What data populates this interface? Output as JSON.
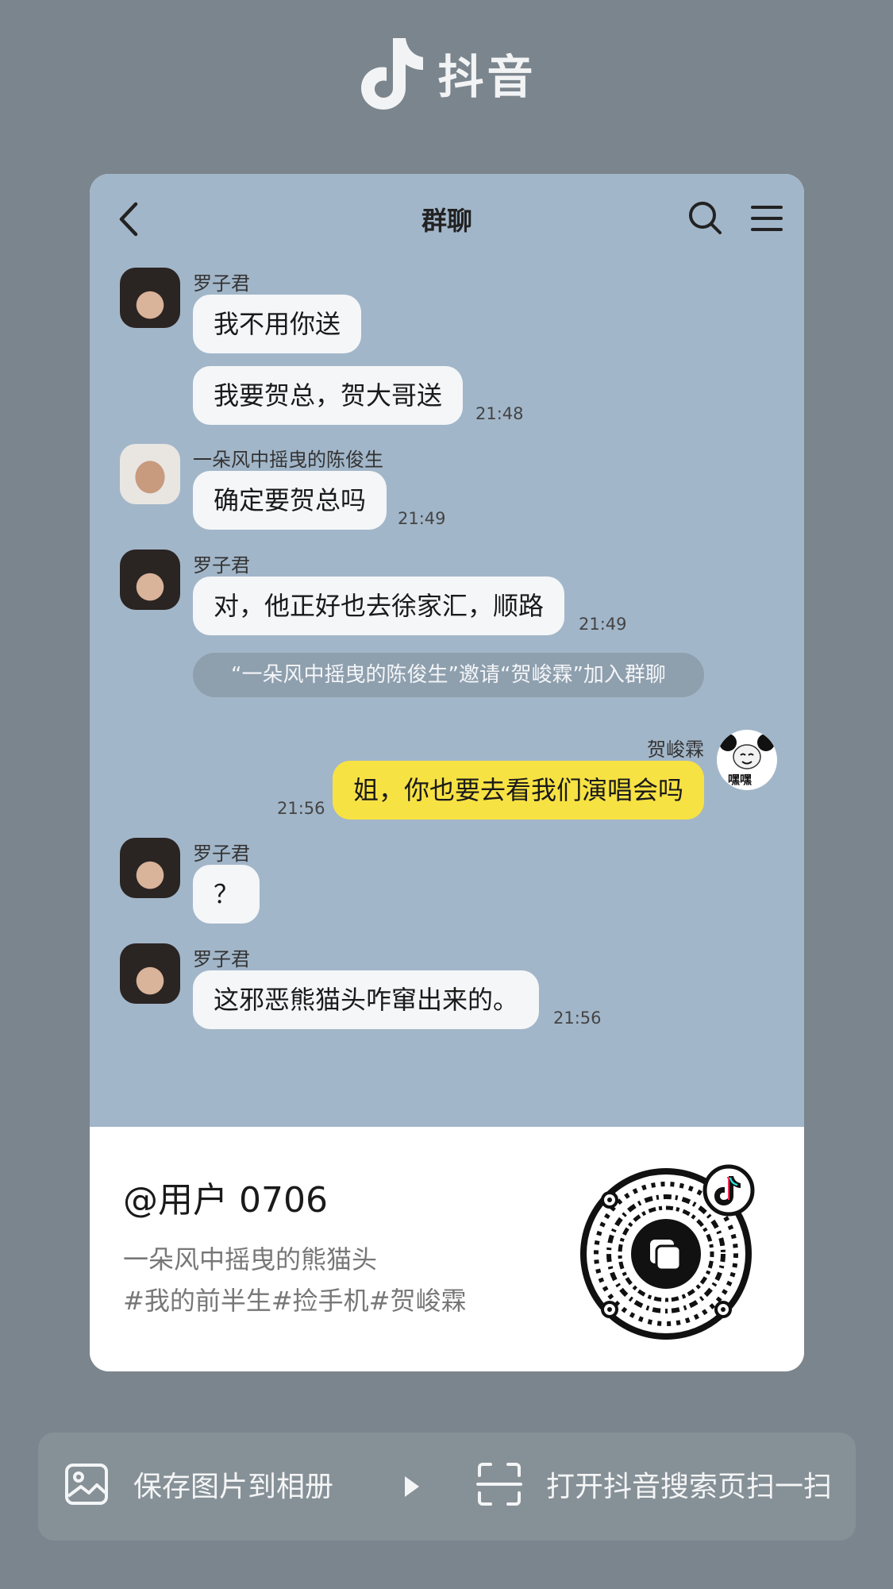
{
  "brand": {
    "name": "抖音"
  },
  "chat": {
    "title": "群聊",
    "messages": [
      {
        "sender": "罗子君",
        "bubbles": [
          "我不用你送",
          "我要贺总，贺大哥送"
        ],
        "time": "21:48"
      },
      {
        "sender": "一朵风中摇曳的陈俊生",
        "bubbles": [
          "确定要贺总吗"
        ],
        "time": "21:49"
      },
      {
        "sender": "罗子君",
        "bubbles": [
          "对，他正好也去徐家汇，顺路"
        ],
        "time": "21:49"
      },
      {
        "system": "“一朵风中摇曳的陈俊生”邀请“贺峻霖”加入群聊"
      },
      {
        "sender": "贺峻霖",
        "bubbles": [
          "姐，你也要去看我们演唱会吗"
        ],
        "time": "21:56",
        "avatar_text": "嘿嘿"
      },
      {
        "sender": "罗子君",
        "bubbles": [
          "？"
        ]
      },
      {
        "sender": "罗子君",
        "bubbles": [
          "这邪恶熊猫头咋窜出来的。"
        ],
        "time": "21:56"
      }
    ]
  },
  "info": {
    "username": "@用户 0706",
    "desc_line1": "一朵风中摇曳的熊猫头",
    "desc_line2": "#我的前半生#捡手机#贺峻霖"
  },
  "actions": {
    "save_label": "保存图片到相册",
    "scan_label": "打开抖音搜索页扫一扫"
  },
  "colors": {
    "background": "#7b858d",
    "chat_bg": "#a2b6c9",
    "bubble": "#f4f6f8",
    "bubble_self": "#f7e244"
  }
}
